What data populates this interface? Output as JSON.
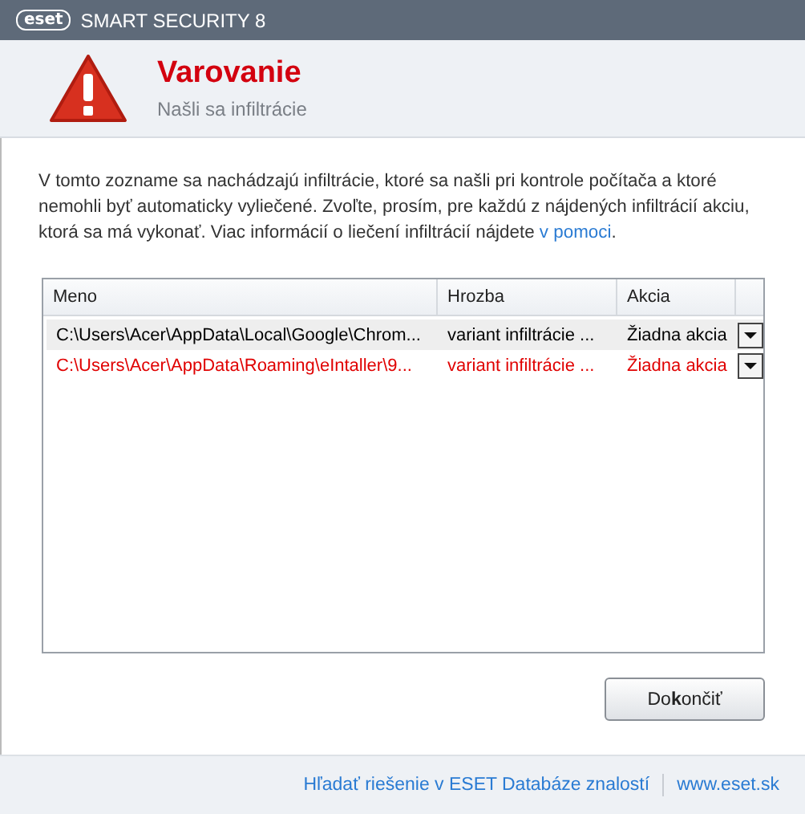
{
  "window": {
    "brand": "eset",
    "title": "SMART SECURITY 8"
  },
  "header": {
    "title": "Varovanie",
    "subtitle": "Našli sa infiltrácie"
  },
  "message": {
    "text": "V tomto zozname sa nachádzajú infiltrácie, ktoré sa našli pri kontrole počítača a ktoré nemohli byť automaticky vyliečené. Zvoľte, prosím, pre každú z nájdených infiltrácií akciu, ktorá sa má vykonať. Viac informácií o liečení infiltrácií nájdete ",
    "link": "v pomoci",
    "end": "."
  },
  "table": {
    "columns": [
      "Meno",
      "Hrozba",
      "Akcia"
    ],
    "rows": [
      {
        "name": "C:\\Users\\Acer\\AppData\\Local\\Google\\Chrom...",
        "threat": "variant infiltrácie ...",
        "action": "Žiadna akcia",
        "selected": true,
        "color": "#000000"
      },
      {
        "name": "C:\\Users\\Acer\\AppData\\Roaming\\eIntaller\\9...",
        "threat": "variant infiltrácie ...",
        "action": "Žiadna akcia",
        "selected": false,
        "color": "#e00000"
      }
    ]
  },
  "buttons": [
    {
      "label": "Do**k**ončiť"
    }
  ],
  "footer": {
    "links": [
      "Hľadať riešenie v ESET Databáze znalostí",
      "www.eset.sk"
    ]
  }
}
